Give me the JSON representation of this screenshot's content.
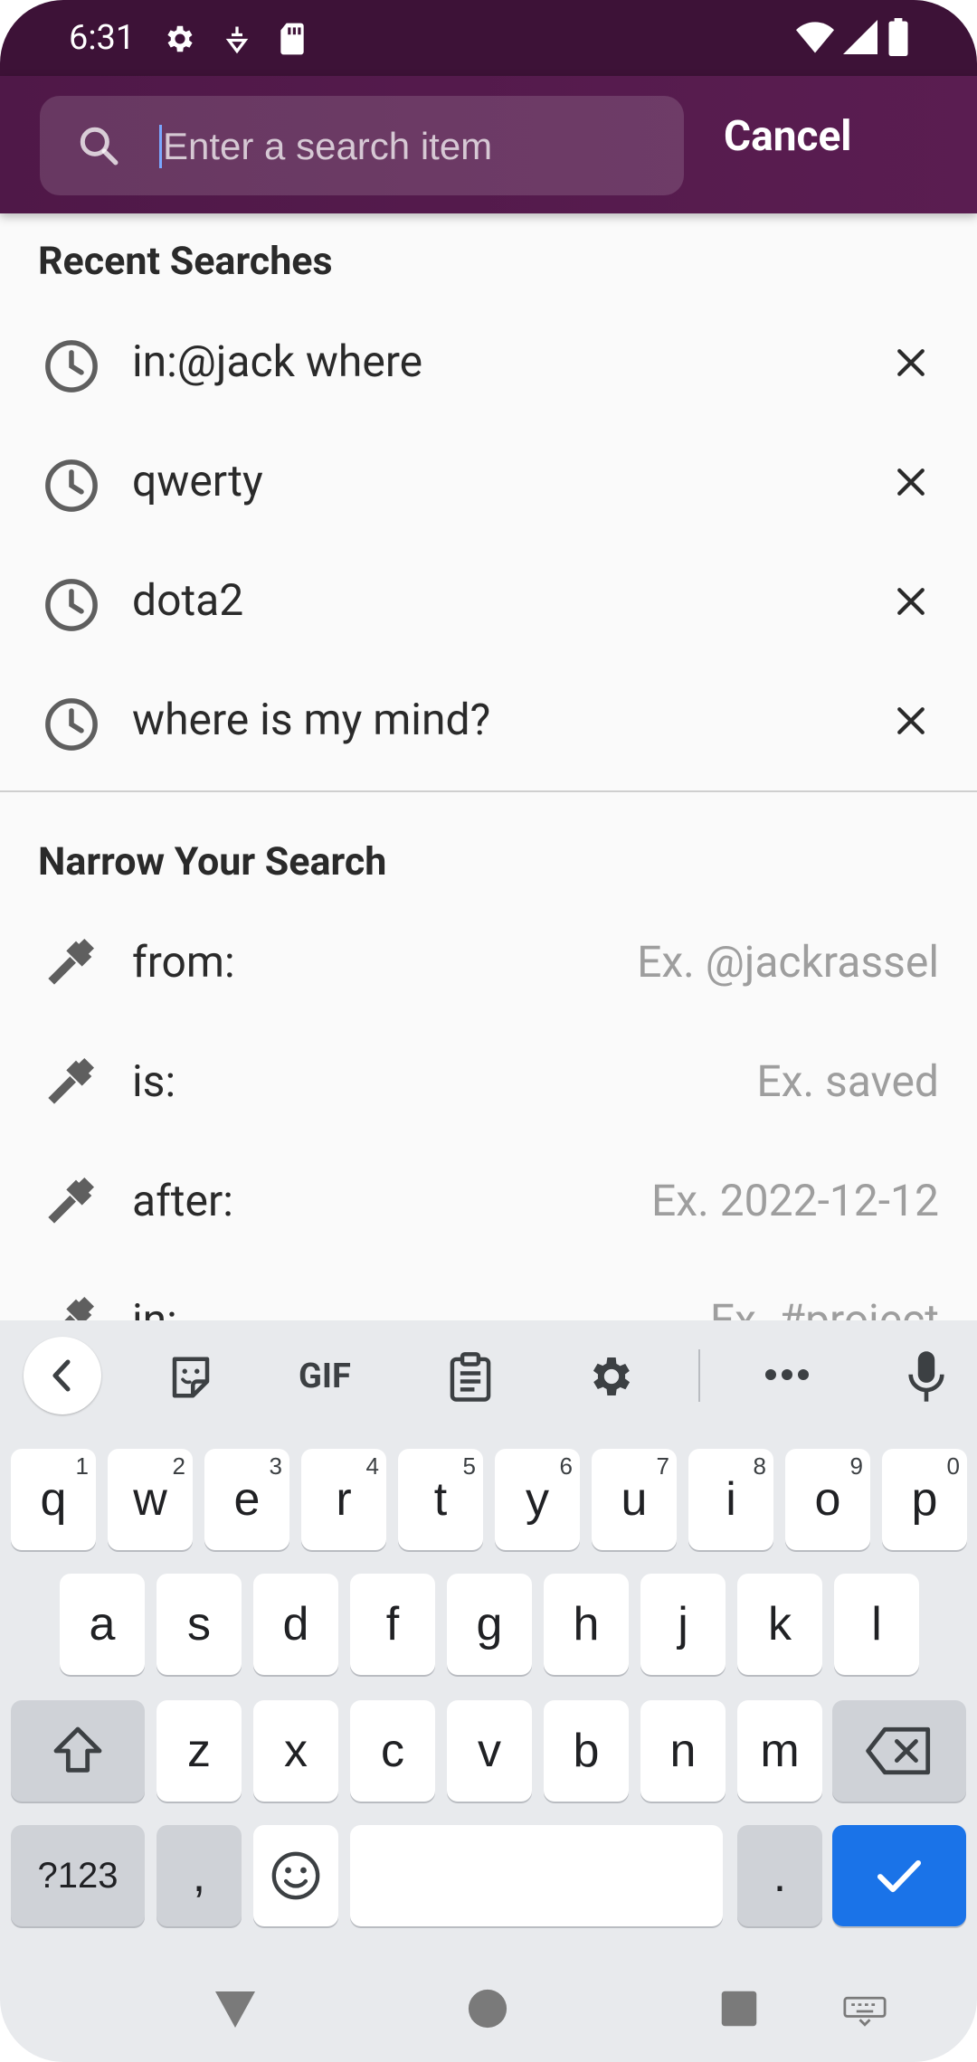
{
  "status_bar": {
    "time": "6:31",
    "left_icons": [
      "gear-icon",
      "sim-icon",
      "sd-card-icon"
    ],
    "right_icons": [
      "wifi-icon",
      "signal-icon",
      "battery-icon"
    ]
  },
  "header": {
    "search_placeholder": "Enter a search item",
    "search_value": "",
    "cancel_label": "Cancel"
  },
  "recent": {
    "title": "Recent Searches",
    "items": [
      {
        "label": "in:@jack where"
      },
      {
        "label": "qwerty"
      },
      {
        "label": "dota2"
      },
      {
        "label": "where is my mind?"
      }
    ]
  },
  "narrow": {
    "title": "Narrow Your Search",
    "items": [
      {
        "label": "from:",
        "hint": "Ex. @jackrassel"
      },
      {
        "label": "is:",
        "hint": "Ex. saved"
      },
      {
        "label": "after:",
        "hint": "Ex. 2022-12-12"
      },
      {
        "label": "in:",
        "hint": "Ex. #project"
      }
    ]
  },
  "keyboard": {
    "toolbar_icons": [
      "chevron-left-icon",
      "sticker-icon",
      "gif-icon",
      "clipboard-icon",
      "settings-icon",
      "more-icon",
      "microphone-icon"
    ],
    "gif_label": "GIF",
    "row1": [
      {
        "k": "q",
        "n": "1"
      },
      {
        "k": "w",
        "n": "2"
      },
      {
        "k": "e",
        "n": "3"
      },
      {
        "k": "r",
        "n": "4"
      },
      {
        "k": "t",
        "n": "5"
      },
      {
        "k": "y",
        "n": "6"
      },
      {
        "k": "u",
        "n": "7"
      },
      {
        "k": "i",
        "n": "8"
      },
      {
        "k": "o",
        "n": "9"
      },
      {
        "k": "p",
        "n": "0"
      }
    ],
    "row2": [
      "a",
      "s",
      "d",
      "f",
      "g",
      "h",
      "j",
      "k",
      "l"
    ],
    "row3": [
      "z",
      "x",
      "c",
      "v",
      "b",
      "n",
      "m"
    ],
    "symbols_label": "?123",
    "comma_label": ",",
    "period_label": ".",
    "accent": "#1a73e8"
  },
  "nav_icons": [
    "back-icon",
    "home-icon",
    "recents-icon",
    "keyboard-switch-icon"
  ]
}
